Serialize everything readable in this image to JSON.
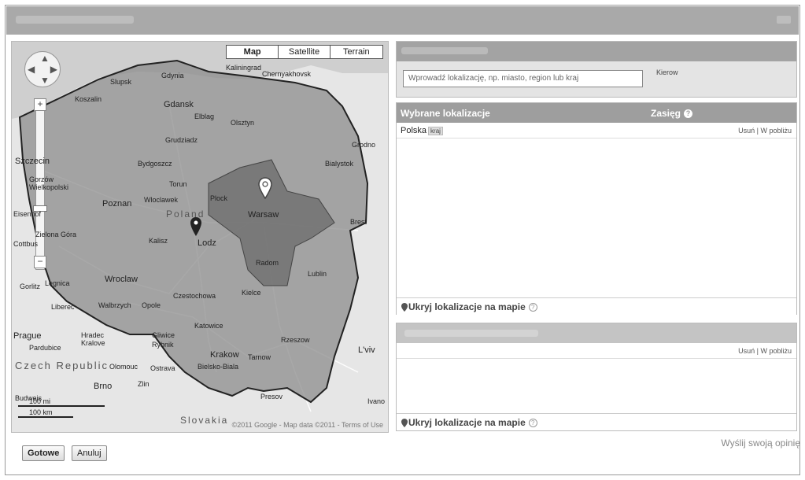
{
  "map": {
    "type_buttons": [
      "Map",
      "Satellite",
      "Terrain"
    ],
    "country_label": "Poland",
    "cities": [
      {
        "name": "Kaliningrad"
      },
      {
        "name": "Chernyakhovsk"
      },
      {
        "name": "Slupsk"
      },
      {
        "name": "Gdynia"
      },
      {
        "name": "Koszalin"
      },
      {
        "name": "Gdansk"
      },
      {
        "name": "Elblag"
      },
      {
        "name": "Olsztyn"
      },
      {
        "name": "Grudziadz"
      },
      {
        "name": "Grodno"
      },
      {
        "name": "Szczecin"
      },
      {
        "name": "Bydgoszcz"
      },
      {
        "name": "Torun"
      },
      {
        "name": "Bialystok"
      },
      {
        "name": "Gorzów Wielkopolski"
      },
      {
        "name": "Wloclawek"
      },
      {
        "name": "Plock"
      },
      {
        "name": "Poznan"
      },
      {
        "name": "Warsaw"
      },
      {
        "name": "Brest"
      },
      {
        "name": "Zielona Góra"
      },
      {
        "name": "Kalisz"
      },
      {
        "name": "Lodz"
      },
      {
        "name": "Radom"
      },
      {
        "name": "Lublin"
      },
      {
        "name": "Legnica"
      },
      {
        "name": "Wroclaw"
      },
      {
        "name": "Czestochowa"
      },
      {
        "name": "Kielce"
      },
      {
        "name": "Walbrzych"
      },
      {
        "name": "Opole"
      },
      {
        "name": "Katowice"
      },
      {
        "name": "Gliwice"
      },
      {
        "name": "Rybnik"
      },
      {
        "name": "Krakow"
      },
      {
        "name": "Rzeszow"
      },
      {
        "name": "Tarnow"
      },
      {
        "name": "L'viv"
      },
      {
        "name": "Prague"
      },
      {
        "name": "Pardubice"
      },
      {
        "name": "Hradec Kralove"
      },
      {
        "name": "Olomouc"
      },
      {
        "name": "Ostrava"
      },
      {
        "name": "Bielsko-Biala"
      },
      {
        "name": "Brno"
      },
      {
        "name": "Zlin"
      },
      {
        "name": "Presov"
      },
      {
        "name": "Budweis"
      },
      {
        "name": "Ivano"
      },
      {
        "name": "Liberec"
      },
      {
        "name": "Gorlitz"
      },
      {
        "name": "Cottbus"
      },
      {
        "name": "Eisenhof"
      }
    ],
    "czech_label": "Czech Republic",
    "slovakia_label": "Slovakia",
    "scale_mi": "100 mi",
    "scale_km": "100 km",
    "copyright": "©2011 Google - Map data ©2011 - Terms of Use"
  },
  "search": {
    "placeholder": "Wprowadź lokalizację, np. miasto, region lub kraj",
    "side_text": "Kierow"
  },
  "selected": {
    "header_locations": "Wybrane lokalizacje",
    "header_range": "Zasięg",
    "rows": [
      {
        "name": "Polska",
        "badge": "kraj",
        "links": "Usuń | W pobliżu"
      }
    ],
    "hide_label": "Ukryj lokalizacje na mapie"
  },
  "excluded": {
    "rows": [
      {
        "links": "Usuń | W pobliżu"
      }
    ],
    "hide_label": "Ukryj lokalizacje na mapie"
  },
  "feedback_link": "Wyślij swoją opinię",
  "buttons": {
    "done": "Gotowe",
    "cancel": "Anuluj"
  }
}
